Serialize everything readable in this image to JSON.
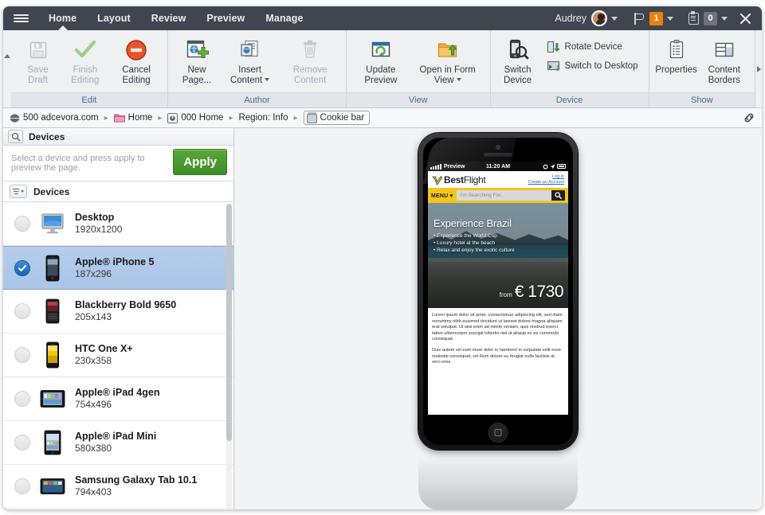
{
  "titlebar": {
    "menu_icon": "hamburger-icon",
    "tabs": [
      {
        "label": "Home",
        "active": true
      },
      {
        "label": "Layout",
        "active": false
      },
      {
        "label": "Review",
        "active": false
      },
      {
        "label": "Preview",
        "active": false
      },
      {
        "label": "Manage",
        "active": false
      }
    ],
    "user_name": "Audrey",
    "flag_badge": "1",
    "clipboard_badge": "0",
    "close_label": "×"
  },
  "ribbon": {
    "groups": [
      {
        "title": "Edit",
        "buttons": [
          {
            "label": "Save Draft",
            "icon": "floppy-disk-icon",
            "disabled": true
          },
          {
            "label": "Finish Editing",
            "icon": "checkmark-icon",
            "disabled": true
          },
          {
            "label": "Cancel Editing",
            "icon": "cancel-circle-icon",
            "disabled": false
          }
        ]
      },
      {
        "title": "Author",
        "buttons": [
          {
            "label": "New Page...",
            "icon": "new-page-icon",
            "disabled": false
          },
          {
            "label": "Insert Content",
            "icon": "insert-content-icon",
            "disabled": false,
            "dropdown": true
          },
          {
            "label": "Remove Content",
            "icon": "trash-icon",
            "disabled": true
          }
        ]
      },
      {
        "title": "View",
        "buttons": [
          {
            "label": "Update Preview",
            "icon": "refresh-window-icon",
            "disabled": false
          },
          {
            "label": "Open in Form View",
            "icon": "folder-arrow-icon",
            "disabled": false,
            "dropdown": true
          }
        ]
      },
      {
        "title": "Device",
        "buttons": [
          {
            "label": "Switch Device",
            "icon": "phone-search-icon",
            "disabled": false
          }
        ],
        "small_buttons": [
          {
            "label": "Rotate Device",
            "icon": "rotate-device-icon"
          },
          {
            "label": "Switch to Desktop",
            "icon": "switch-desktop-icon"
          }
        ]
      },
      {
        "title": "Show",
        "buttons": [
          {
            "label": "Properties",
            "icon": "clipboard-list-icon",
            "disabled": false
          },
          {
            "label": "Content Borders",
            "icon": "content-borders-icon",
            "disabled": false
          }
        ]
      }
    ]
  },
  "breadcrumb": {
    "items": [
      {
        "label": "500 adcevora.com",
        "icon": "globe-icon",
        "boxed": false
      },
      {
        "label": "Home",
        "icon": "folder-icon",
        "boxed": false
      },
      {
        "label": "000 Home",
        "icon": "page-icon",
        "boxed": false
      },
      {
        "label": "Region: Info",
        "icon": "",
        "boxed": false
      },
      {
        "label": "Cookie bar",
        "icon": "component-icon",
        "boxed": true
      }
    ],
    "separator": "▸",
    "link_icon": "chain-link-icon"
  },
  "panel": {
    "header_title": "Devices",
    "header_icon": "search-icon",
    "apply_hint": "Select a device and press apply to preview the page.",
    "apply_label": "Apply",
    "section_title": "Devices",
    "section_icon": "list-dropdown-icon",
    "devices": [
      {
        "name": "Desktop",
        "resolution": "1920x1200",
        "selected": false,
        "thumb": "desktop-monitor"
      },
      {
        "name": "Apple® iPhone 5",
        "resolution": "187x296",
        "selected": true,
        "thumb": "iphone"
      },
      {
        "name": "Blackberry Bold 9650",
        "resolution": "205x143",
        "selected": false,
        "thumb": "blackberry"
      },
      {
        "name": "HTC One X+",
        "resolution": "230x358",
        "selected": false,
        "thumb": "htc"
      },
      {
        "name": "Apple® iPad 4gen",
        "resolution": "754x496",
        "selected": false,
        "thumb": "ipad"
      },
      {
        "name": "Apple® iPad Mini",
        "resolution": "580x380",
        "selected": false,
        "thumb": "ipad-mini"
      },
      {
        "name": "Samsung Galaxy Tab 10.1",
        "resolution": "794x403",
        "selected": false,
        "thumb": "galaxy-tab"
      }
    ]
  },
  "preview": {
    "device_frame": "apple-iphone-5-black",
    "status_bar": {
      "carrier": "Preview",
      "time": "11:20 AM"
    },
    "site": {
      "brand_bold": "Best",
      "brand_light": "Flight",
      "login_label": "Log in",
      "create_account_label": "Create an Account",
      "menu_label": "MENU",
      "search_placeholder": "I'm Searching For...",
      "hero": {
        "title": "Experience Brazil",
        "bullets": [
          "Experience the World Cup",
          "Luxury hotel at the beach",
          "Relax and enjoy the exotic culture"
        ],
        "price_prefix": "from",
        "price": "€ 1730"
      },
      "paragraphs": [
        "Lorem ipsum dolor sit amet, consectetuer adipiscing elit, sed diam nonummy nibh euismod tincidunt ut laoreet dolore magna aliquam erat volutpat. Ut wisi enim ad minim veniam, quis nostrud exerci tation ullamcorper suscipit lobortis nisl ut aliquip ex ea commodo consequat.",
        "Duis autem vel eum iriure dolor in hendrerit in vulputate velit esse molestie consequat, vel illum dolore eu feugiat nulla facilisis at vero eros."
      ]
    }
  },
  "colors": {
    "titlebar_bg": "#414550",
    "ribbon_bg": "#eef0f2",
    "accent_orange": "#e8820c",
    "apply_green": "#3f8c27",
    "selection_blue": "#a9c5e8",
    "brand_yellow": "#f5c518"
  }
}
